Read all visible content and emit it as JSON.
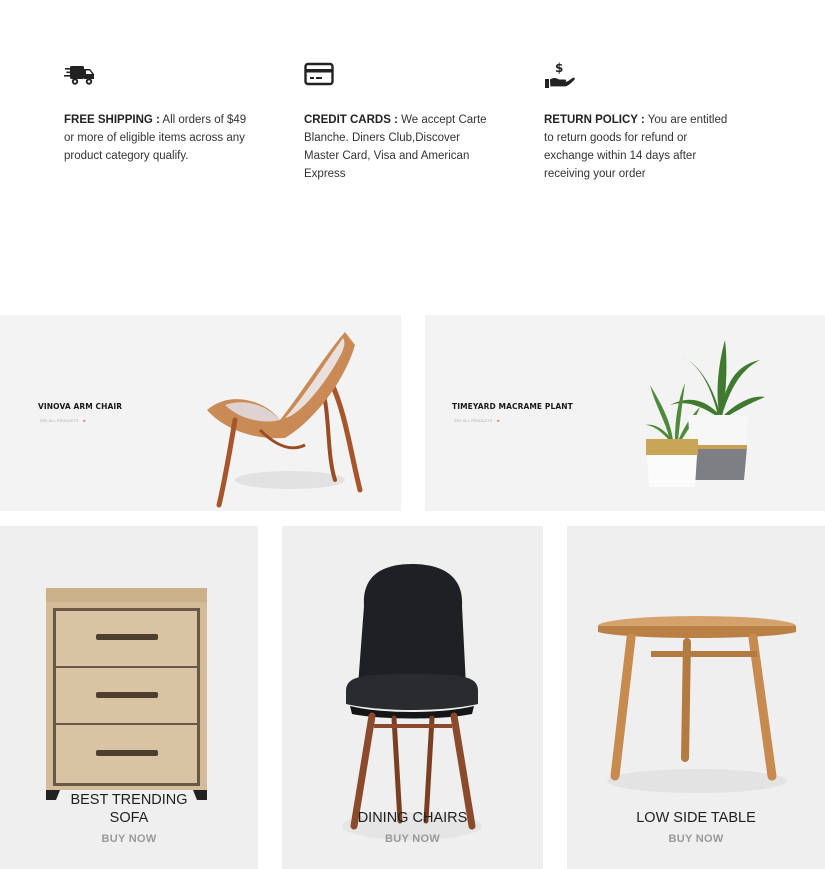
{
  "features": [
    {
      "icon": "delivery-truck-icon",
      "title": "FREE SHIPPING :",
      "text": "All orders of $49 or more of eligible items across any product category qualify."
    },
    {
      "icon": "credit-card-icon",
      "title": "CREDIT CARDS :",
      "text": "We accept Carte Blanche. Diners Club,Discover Master Card, Visa and American Express"
    },
    {
      "icon": "money-hand-icon",
      "title": "RETURN POLICY :",
      "text": "You are entitled to return goods for refund or exchange within 14 days after receiving your order"
    }
  ],
  "banners": [
    {
      "title": "VINOVA ARM CHAIR",
      "link": "SEE ALL PRODUCTS"
    },
    {
      "title": "TIMEYARD MACRAME PLANT",
      "link": "SEE ALL PRODUCTS"
    }
  ],
  "categories": [
    {
      "title_line1": "BEST TRENDING",
      "title_line2": "SOFA",
      "button": "BUY NOW"
    },
    {
      "title": "DINING CHAIRS",
      "button": "BUY NOW"
    },
    {
      "title": "LOW SIDE TABLE",
      "button": "BUY NOW"
    }
  ]
}
